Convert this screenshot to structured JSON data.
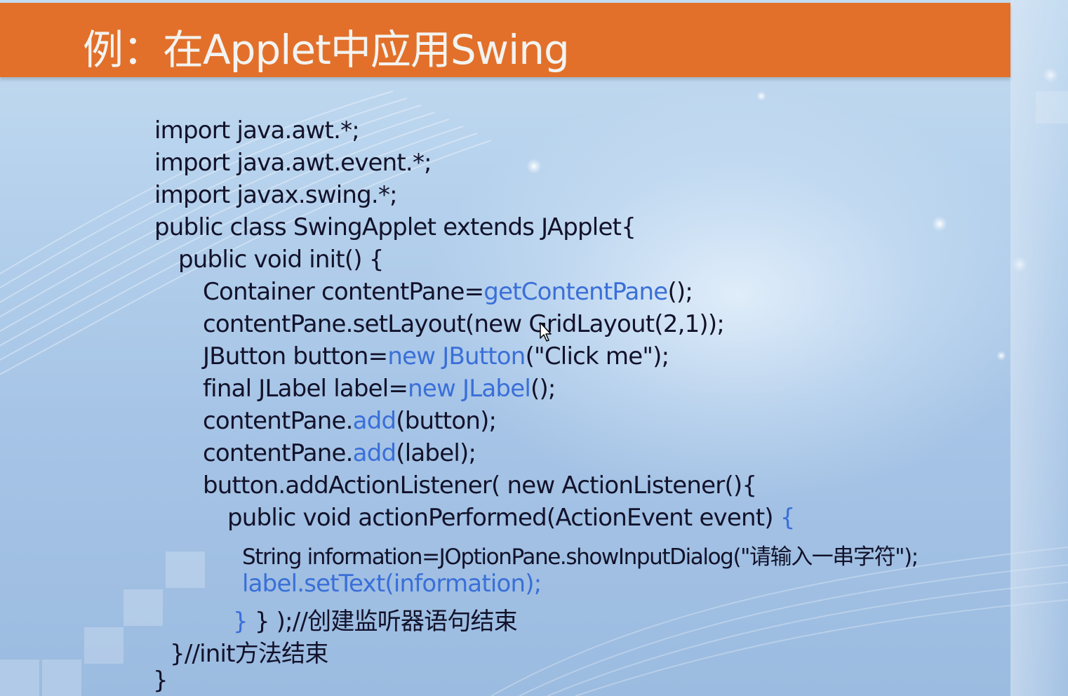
{
  "slide": {
    "title": "例：在Applet中应用Swing"
  },
  "code": {
    "lines": [
      {
        "text": "import java.awt.*;"
      },
      {
        "text": "import java.awt.event.*;"
      },
      {
        "text": "import javax.swing.*;"
      },
      {
        "text": "public class SwingApplet extends JApplet{"
      },
      {
        "text": "public void init() {"
      },
      {
        "a": "Container contentPane=",
        "b": "getContentPane",
        "c": "();"
      },
      {
        "text": "contentPane.setLayout(new GridLayout(2,1));"
      },
      {
        "a": "JButton button=",
        "b": "new JButton",
        "c": "(\"Click me\");"
      },
      {
        "a": "final JLabel label=",
        "b": "new JLabel",
        "c": "();"
      },
      {
        "a": "contentPane.",
        "b": "add",
        "c": "(button);"
      },
      {
        "a": "contentPane.",
        "b": "add",
        "c": "(label);"
      },
      {
        "text": "button.addActionListener( new ActionListener(){"
      },
      {
        "a": "public void actionPerformed(ActionEvent event) ",
        "b": "{"
      },
      {
        "text": "String information=JOptionPane.showInputDialog(\"请输入一串字符\");"
      },
      {
        "text": "label.setText(information);"
      },
      {
        "a": "} ",
        "b": "}  );//创建监听器语句结束"
      },
      {
        "text": "}//init方法结束"
      },
      {
        "text": "}"
      }
    ]
  },
  "colors": {
    "title_bar": "#e2702a",
    "code_text": "#12122a",
    "highlight": "#3a6fd8"
  },
  "icons": {
    "cursor": "mouse-pointer-icon"
  }
}
